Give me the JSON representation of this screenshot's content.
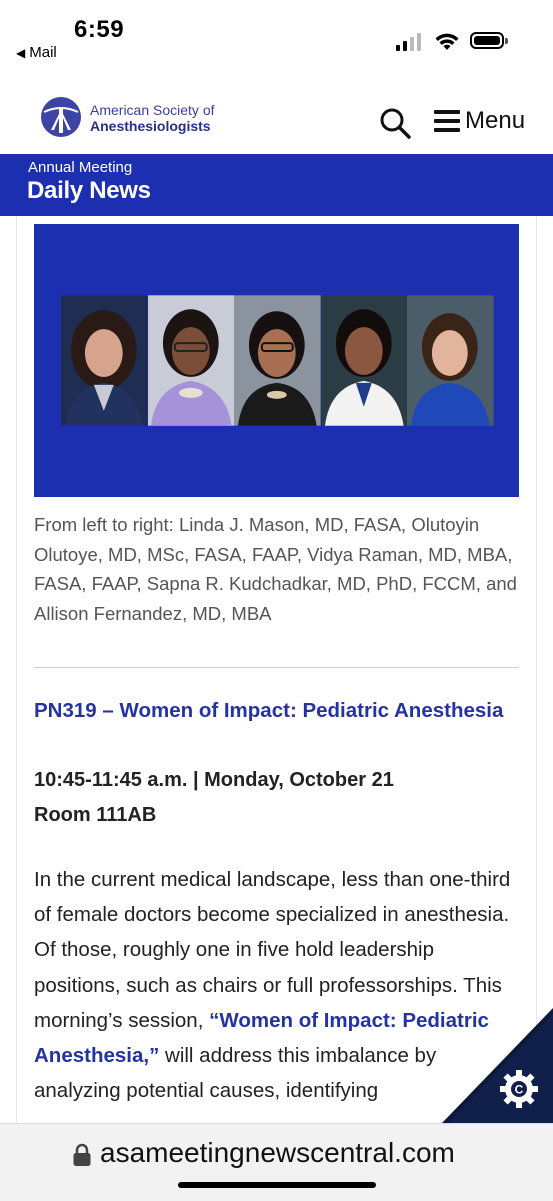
{
  "status_bar": {
    "time": "6:59",
    "back_label": "Mail",
    "back_icon": "back-triangle-icon"
  },
  "header": {
    "logo_line1": "American Society of",
    "logo_line2": "Anesthesiologists",
    "logo_icon": "asa-logo-icon",
    "menu_label": "Menu"
  },
  "banner": {
    "subtitle": "Annual Meeting",
    "title": "Daily News"
  },
  "article": {
    "caption": "From left to right: Linda J. Mason, MD, FASA, Olutoyin Olutoye, MD, MSc, FASA, FAAP, Vidya Raman, MD, MBA, FASA, FAAP, Sapna R. Kudchadkar, MD, PhD, FCCM, and Allison Fernandez, MD, MBA",
    "session_title": "PN319 – Women of Impact: Pediatric Anesthesia",
    "session_time": "10:45-11:45 a.m. | Monday, October 21",
    "session_room": "Room 111AB",
    "body_part1": "In the current medical landscape, less than one-third of female doctors become specialized in anesthesia. Of those, roughly one in five hold leadership positions, such as chairs or full professorships. This morning’s session, ",
    "body_link": "“Women of Impact: Pediatric Anesthesia,”",
    "body_part2": " will address this imbalance by analyzing potential causes, identifying"
  },
  "url_bar": {
    "url": "asameetingnewscentral.com"
  },
  "colors": {
    "brand_blue": "#1b2fb0",
    "link_blue": "#2433a3"
  }
}
